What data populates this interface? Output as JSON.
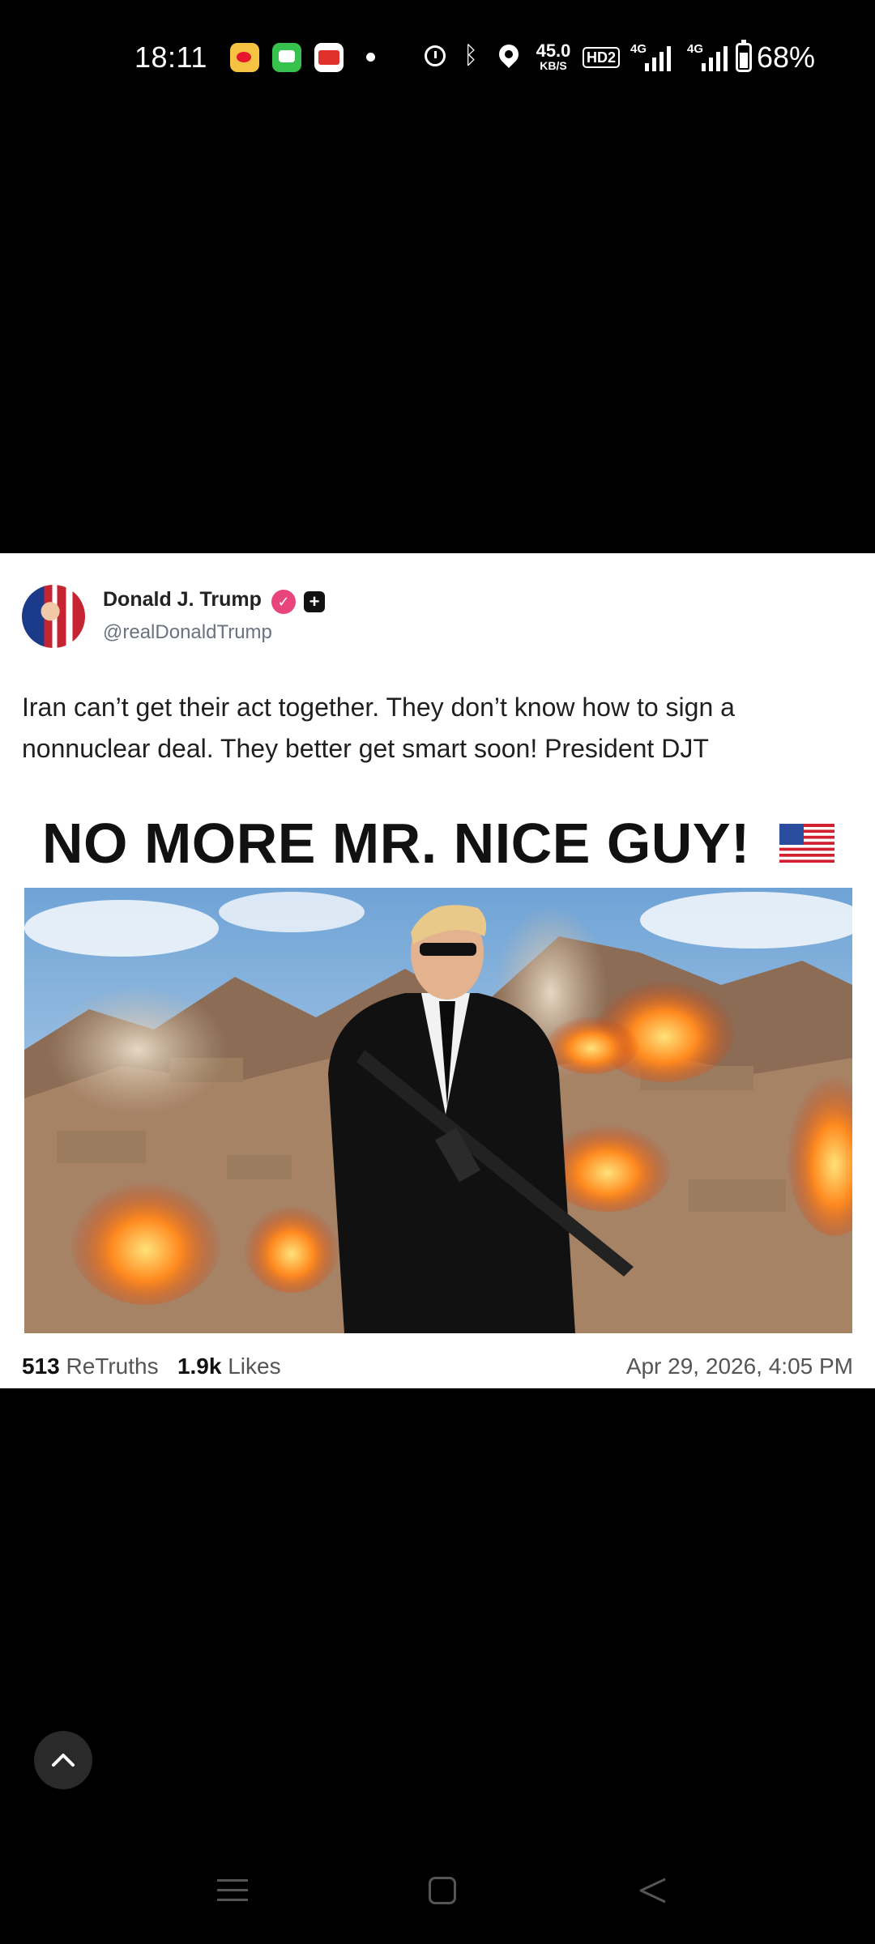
{
  "status_bar": {
    "time": "18:11",
    "net_speed_value": "45.0",
    "net_speed_unit": "KB/S",
    "hd_badge": "HD2",
    "signal1": "4G",
    "signal2": "4G",
    "battery": "68%",
    "icons": [
      "weibo-icon",
      "messages-icon",
      "toutiao-icon",
      "notification-dot-icon",
      "alarm-icon",
      "bluetooth-icon",
      "location-icon",
      "signal-icon",
      "battery-icon"
    ]
  },
  "post": {
    "author_name": "Donald J. Trump",
    "handle": "@realDonaldTrump",
    "text": "Iran can’t get their act together. They don’t know how to sign a nonnuclear deal. They better get smart soon! President DJT",
    "image_headline": "NO MORE MR. NICE GUY!",
    "retruths_count": "513",
    "retruths_label": "ReTruths",
    "likes_count": "1.9k",
    "likes_label": "Likes",
    "timestamp": "Apr 29, 2026, 4:05 PM"
  },
  "colors": {
    "card_bg": "#ffffff",
    "screen_bg": "#000000",
    "verified": "#e8457c"
  }
}
